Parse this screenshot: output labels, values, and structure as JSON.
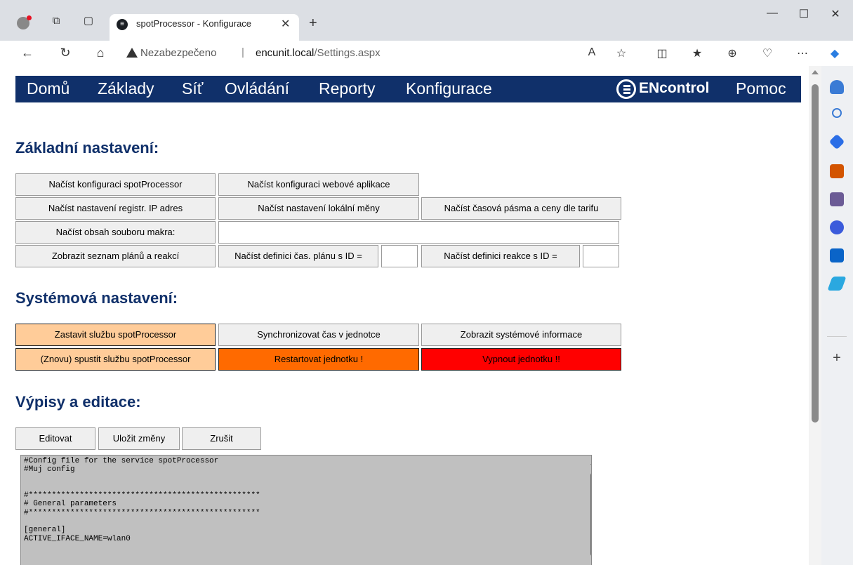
{
  "browser": {
    "tab_title": "spotProcessor - Konfigurace",
    "security_label": "Nezabezpečeno",
    "url_host": "encunit.local",
    "url_path": "/Settings.aspx"
  },
  "menu": {
    "items": [
      "Domů",
      "Základy",
      "Síť",
      "Ovládání",
      "Reporty",
      "Konfigurace"
    ],
    "logo_text": "ENcontrol",
    "help": "Pomoc"
  },
  "basic": {
    "title": "Základní nastavení:",
    "load_spot_config": "Načíst konfiguraci spotProcessor",
    "load_web_config": "Načíst konfiguraci webové aplikace",
    "load_ip_registration": "Načíst nastavení registr. IP adres",
    "load_local_currency": "Načíst nastavení lokální měny",
    "load_time_zones": "Načíst časová pásma a ceny dle tarifu",
    "load_macro_file": "Načíst obsah souboru makra:",
    "macro_file_value": "",
    "show_plans": "Zobrazit seznam plánů a reakcí",
    "load_plan_def": "Načíst definici čas. plánu s ID =",
    "plan_id_value": "",
    "load_reaction_def": "Načíst definici reakce s ID =",
    "reaction_id_value": ""
  },
  "system": {
    "title": "Systémová nastavení:",
    "stop_service": "Zastavit službu spotProcessor",
    "sync_time": "Synchronizovat čas v jednotce",
    "show_system_info": "Zobrazit systémové informace",
    "restart_service": "(Znovu) spustit službu spotProcessor",
    "restart_unit": "Restartovat jednotku !",
    "shutdown_unit": "Vypnout jednotku !!"
  },
  "editor": {
    "title": "Výpisy a editace:",
    "edit": "Editovat",
    "save": "Uložit změny",
    "cancel": "Zrušit",
    "content": "#Config file for the service spotProcessor\n#Muj config\n\n\n#**************************************************\n# General parameters\n#**************************************************\n\n[general]\nACTIVE_IFACE_NAME=wlan0"
  },
  "colors": {
    "menu_bg": "#10306a",
    "orange_light": "#ffcc99",
    "orange": "#ff6a00",
    "red": "#ff0000"
  }
}
